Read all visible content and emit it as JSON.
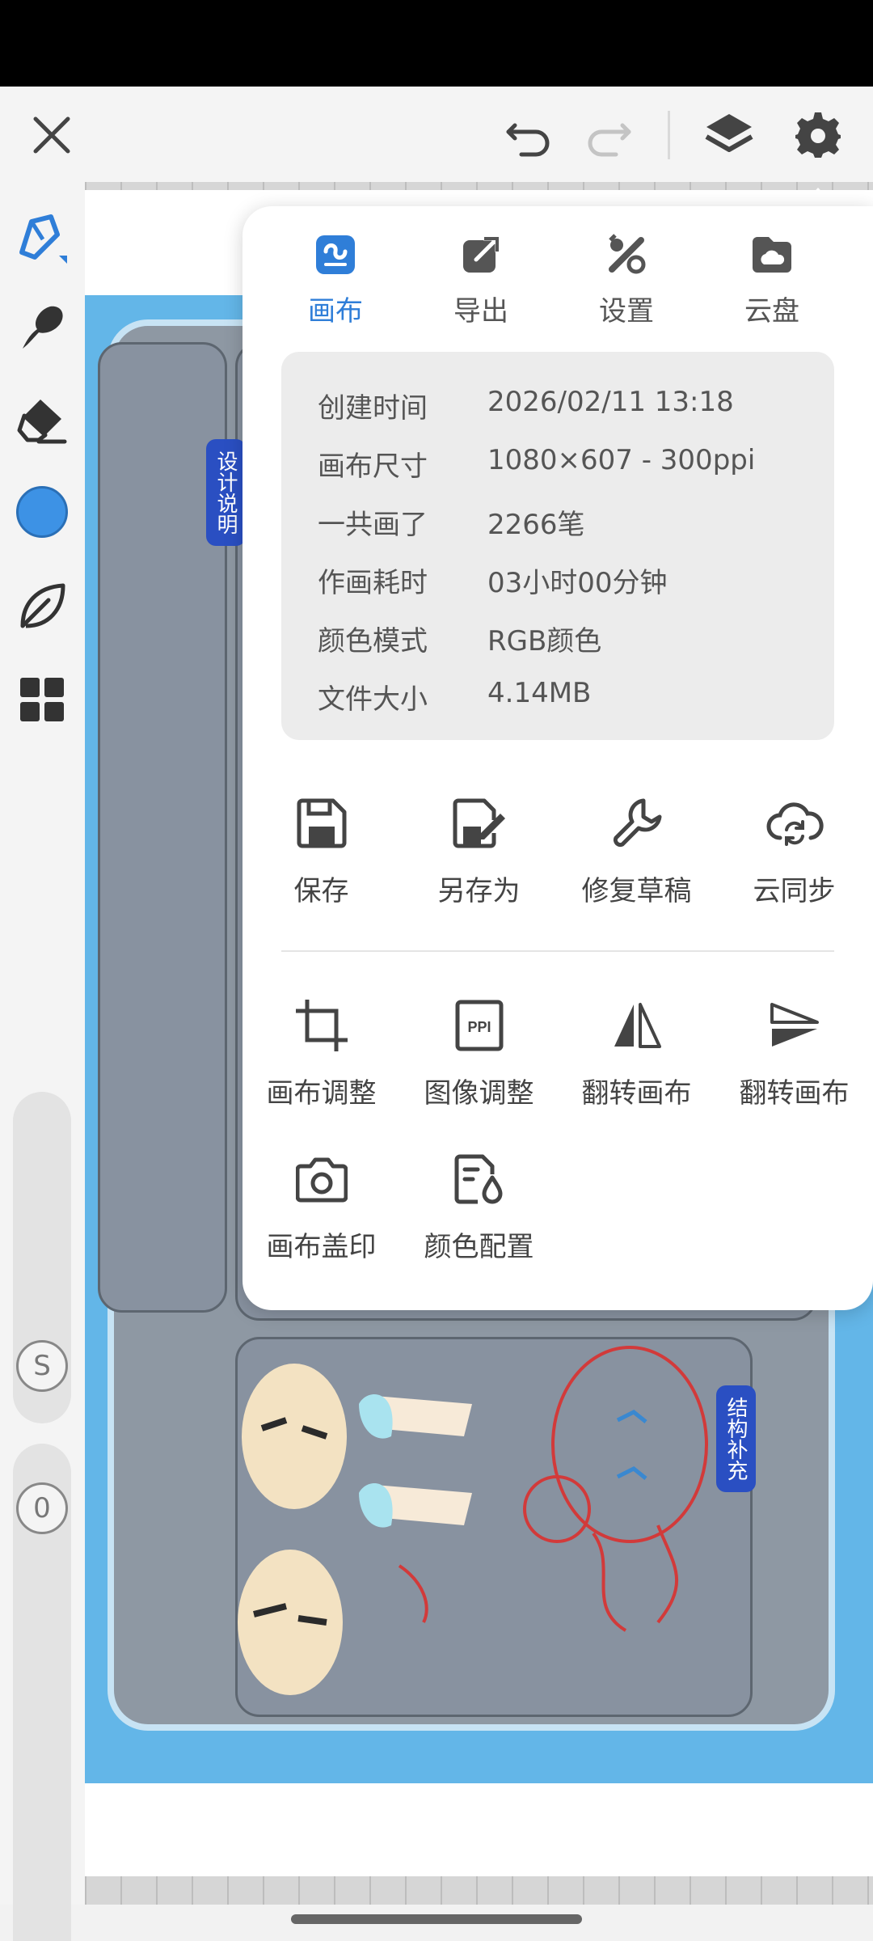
{
  "toolbar": {
    "icons": [
      "close-icon",
      "undo-icon",
      "redo-icon",
      "layers-icon",
      "settings-icon"
    ]
  },
  "left_tools": {
    "icons": [
      "pen-tool-icon",
      "smudge-brush-icon",
      "eraser-icon",
      "color-swatch",
      "leaf-brush-icon",
      "grid-icon"
    ],
    "current_color": "#3d92e5",
    "size_knob_label": "S",
    "opacity_knob_label": "0"
  },
  "panel": {
    "tabs": [
      {
        "label": "画布",
        "icon": "canvas-icon",
        "active": true
      },
      {
        "label": "导出",
        "icon": "export-icon",
        "active": false
      },
      {
        "label": "设置",
        "icon": "tools-icon",
        "active": false
      },
      {
        "label": "云盘",
        "icon": "cloud-drive-icon",
        "active": false
      }
    ],
    "info": [
      {
        "key": "创建时间",
        "value": "2026/02/11 13:18"
      },
      {
        "key": "画布尺寸",
        "value": "1080×607 - 300ppi"
      },
      {
        "key": "一共画了",
        "value": "2266笔"
      },
      {
        "key": "作画耗时",
        "value": "03小时00分钟"
      },
      {
        "key": "颜色模式",
        "value": "RGB颜色"
      },
      {
        "key": "文件大小",
        "value": "4.14MB"
      }
    ],
    "actions_row1": [
      {
        "label": "保存",
        "icon": "save-icon"
      },
      {
        "label": "另存为",
        "icon": "save-as-icon"
      },
      {
        "label": "修复草稿",
        "icon": "wrench-icon"
      },
      {
        "label": "云同步",
        "icon": "cloud-sync-icon"
      }
    ],
    "actions_row2": [
      {
        "label": "画布调整",
        "icon": "crop-icon"
      },
      {
        "label": "图像调整",
        "icon": "ppi-icon",
        "icon_text": "PPI"
      },
      {
        "label": "翻转画布",
        "icon": "flip-horizontal-icon"
      },
      {
        "label": "翻转画布",
        "icon": "flip-vertical-icon"
      }
    ],
    "actions_row3": [
      {
        "label": "画布盖印",
        "icon": "camera-icon"
      },
      {
        "label": "颜色配置",
        "icon": "color-config-icon"
      }
    ]
  },
  "colors": {
    "accent": "#2f7ed8",
    "artwork_blue": "#63b6e8",
    "tag_blue": "#2a4fc2"
  }
}
